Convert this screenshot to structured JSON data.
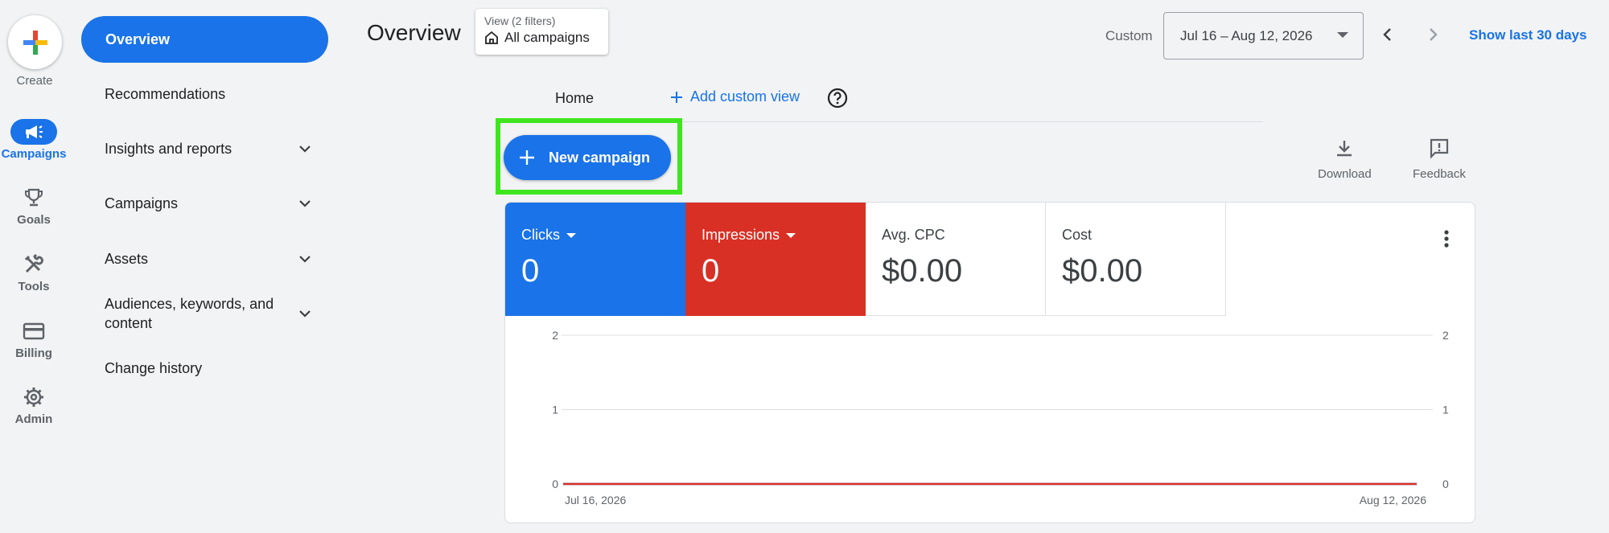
{
  "rail": {
    "create_label": "Create",
    "items": [
      {
        "label": "Campaigns",
        "icon": "megaphone-icon",
        "active": true
      },
      {
        "label": "Goals",
        "icon": "trophy-icon"
      },
      {
        "label": "Tools",
        "icon": "tools-icon"
      },
      {
        "label": "Billing",
        "icon": "credit-card-icon"
      },
      {
        "label": "Admin",
        "icon": "gear-icon"
      }
    ]
  },
  "nav": {
    "overview": "Overview",
    "items": [
      {
        "label": "Recommendations"
      },
      {
        "label": "Insights and reports"
      },
      {
        "label": "Campaigns"
      },
      {
        "label": "Assets"
      },
      {
        "label": "Audiences, keywords, and content"
      },
      {
        "label": "Change history"
      }
    ]
  },
  "header": {
    "title": "Overview",
    "view_sub": "View (2 filters)",
    "view_main": "All campaigns",
    "custom_label": "Custom",
    "date_range": "Jul 16 – Aug 12, 2026",
    "show_last": "Show last 30 days"
  },
  "tabs": {
    "home": "Home",
    "add_view": "Add custom view"
  },
  "actions": {
    "new_campaign": "New campaign",
    "download": "Download",
    "feedback": "Feedback"
  },
  "metrics": [
    {
      "label": "Clicks",
      "value": "0"
    },
    {
      "label": "Impressions",
      "value": "0"
    },
    {
      "label": "Avg. CPC",
      "value": "$0.00"
    },
    {
      "label": "Cost",
      "value": "$0.00"
    }
  ],
  "colors": {
    "accent": "#1a73e8",
    "impressions": "#d93025",
    "highlight": "#3fe51f"
  },
  "chart_data": {
    "type": "line",
    "x": [
      "Jul 16, 2026",
      "Aug 12, 2026"
    ],
    "x_tick_labels": [
      "Jul 16, 2026",
      "Aug 12, 2026"
    ],
    "y_ticks": [
      0,
      1,
      2
    ],
    "ylim": [
      0,
      2
    ],
    "series": [
      {
        "name": "Clicks",
        "values": [
          0,
          0
        ],
        "color": "#1a73e8"
      },
      {
        "name": "Impressions",
        "values": [
          0,
          0
        ],
        "color": "#d93025"
      }
    ],
    "grid": true
  }
}
